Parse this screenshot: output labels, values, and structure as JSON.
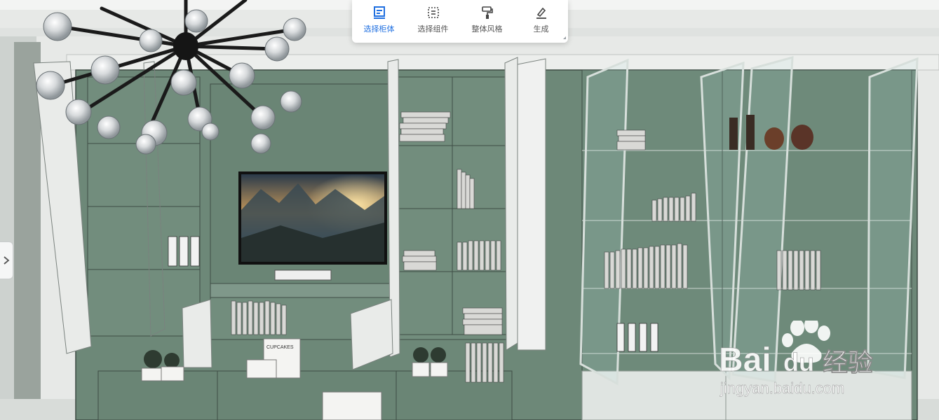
{
  "toolbar": {
    "items": [
      {
        "label": "选择柜体",
        "icon": "cabinet-select-icon",
        "active": true
      },
      {
        "label": "选择组件",
        "icon": "component-select-icon",
        "active": false
      },
      {
        "label": "整体风格",
        "icon": "paint-roller-icon",
        "active": false
      },
      {
        "label": "生成",
        "icon": "generate-icon",
        "active": false
      }
    ]
  },
  "watermark": {
    "brand_left": "Bai",
    "brand_right": "du",
    "brand_cn": "经验",
    "url": "jingyan.baidu.com"
  },
  "colors": {
    "accent": "#1f6fe0",
    "cabinet_green": "#6f8a7a",
    "wall": "#e6e8e6"
  }
}
